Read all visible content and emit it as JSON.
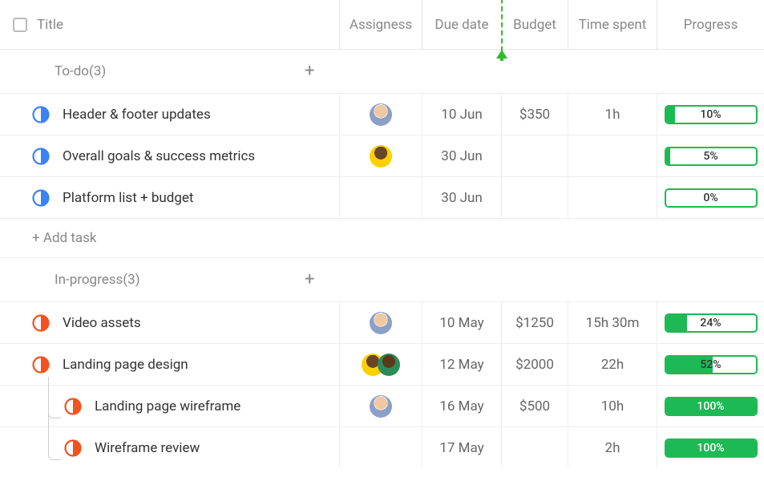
{
  "header": {
    "title": "Title",
    "assignees": "Assigness",
    "due": "Due date",
    "budget": "Budget",
    "time": "Time spent",
    "progress": "Progress"
  },
  "addTaskLabel": "+ Add task",
  "groups": [
    {
      "title": "To-do(3)",
      "addIcon": "+",
      "tasks": [
        {
          "name": "Header & footer updates",
          "status_color": "#3b82f6",
          "assignees": [
            "a"
          ],
          "due": "10 Jun",
          "budget": "$350",
          "time": "1h",
          "progress": 10,
          "progress_label": "10%"
        },
        {
          "name": "Overall goals & success metrics",
          "status_color": "#3b82f6",
          "assignees": [
            "b"
          ],
          "due": "30 Jun",
          "budget": "",
          "time": "",
          "progress": 5,
          "progress_label": "5%"
        },
        {
          "name": "Platform list + budget",
          "status_color": "#3b82f6",
          "assignees": [],
          "due": "30 Jun",
          "budget": "",
          "time": "",
          "progress": 0,
          "progress_label": "0%"
        }
      ]
    },
    {
      "title": "In-progress(3)",
      "addIcon": "+",
      "tasks": [
        {
          "name": "Video assets",
          "status_color": "#f4511e",
          "assignees": [
            "a"
          ],
          "due": "10 May",
          "budget": "$1250",
          "time": "15h 30m",
          "progress": 24,
          "progress_label": "24%"
        },
        {
          "name": "Landing page design",
          "status_color": "#f4511e",
          "assignees": [
            "b",
            "c"
          ],
          "due": "12 May",
          "budget": "$2000",
          "time": "22h",
          "progress": 52,
          "progress_label": "52%"
        },
        {
          "name": "Landing page wireframe",
          "status_color": "#f4511e",
          "assignees": [
            "a"
          ],
          "due": "16 May",
          "budget": "$500",
          "time": "10h",
          "progress": 100,
          "progress_label": "100%",
          "child": true,
          "childIndex": 0
        },
        {
          "name": "Wireframe review",
          "status_color": "#f4511e",
          "assignees": [],
          "due": "17 May",
          "budget": "",
          "time": "2h",
          "progress": 100,
          "progress_label": "100%",
          "child": true,
          "childIndex": 1
        }
      ]
    }
  ]
}
